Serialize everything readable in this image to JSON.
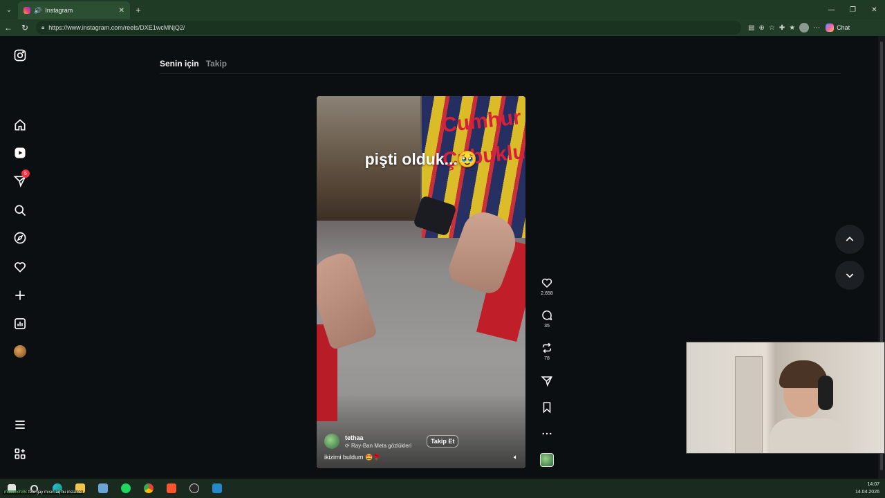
{
  "browser": {
    "tab_title": "Instagram",
    "url": "https://www.instagram.com/reels/DXE1wcMNjQ2/",
    "chat_label": "Chat"
  },
  "feed_tabs": {
    "for_you": "Senin için",
    "following": "Takip"
  },
  "sidebar": {
    "messages_badge": "5"
  },
  "reel": {
    "overlay_text": "pişti olduk...🥹",
    "sign_text_1": "Cumhur",
    "sign_text_2": "Çubuklu",
    "author": "tethaa",
    "audio_label": "Ray-Ban Meta gözlükleri",
    "follow_label": "Takip Et",
    "caption": "ikizimi buldum 🤩🌹"
  },
  "actions": {
    "likes": "2.658",
    "comments": "35",
    "reposts": "78"
  },
  "taskbar": {
    "ticker_user": "moskvich35",
    "ticker_text": ": feto gay mısın aq bu insta ne",
    "time": "14:07",
    "date": "14.04.2026"
  },
  "colors": {
    "accent_badge": "#ff3040",
    "browser_chrome": "#1f3b26"
  },
  "icons": [
    "instagram-logo-icon",
    "home-icon",
    "reels-icon",
    "messages-icon",
    "search-icon",
    "explore-icon",
    "heart-icon",
    "create-icon",
    "dashboard-icon",
    "menu-icon",
    "apps-icon",
    "like-icon",
    "comment-icon",
    "repost-icon",
    "share-icon",
    "save-icon",
    "more-icon"
  ]
}
